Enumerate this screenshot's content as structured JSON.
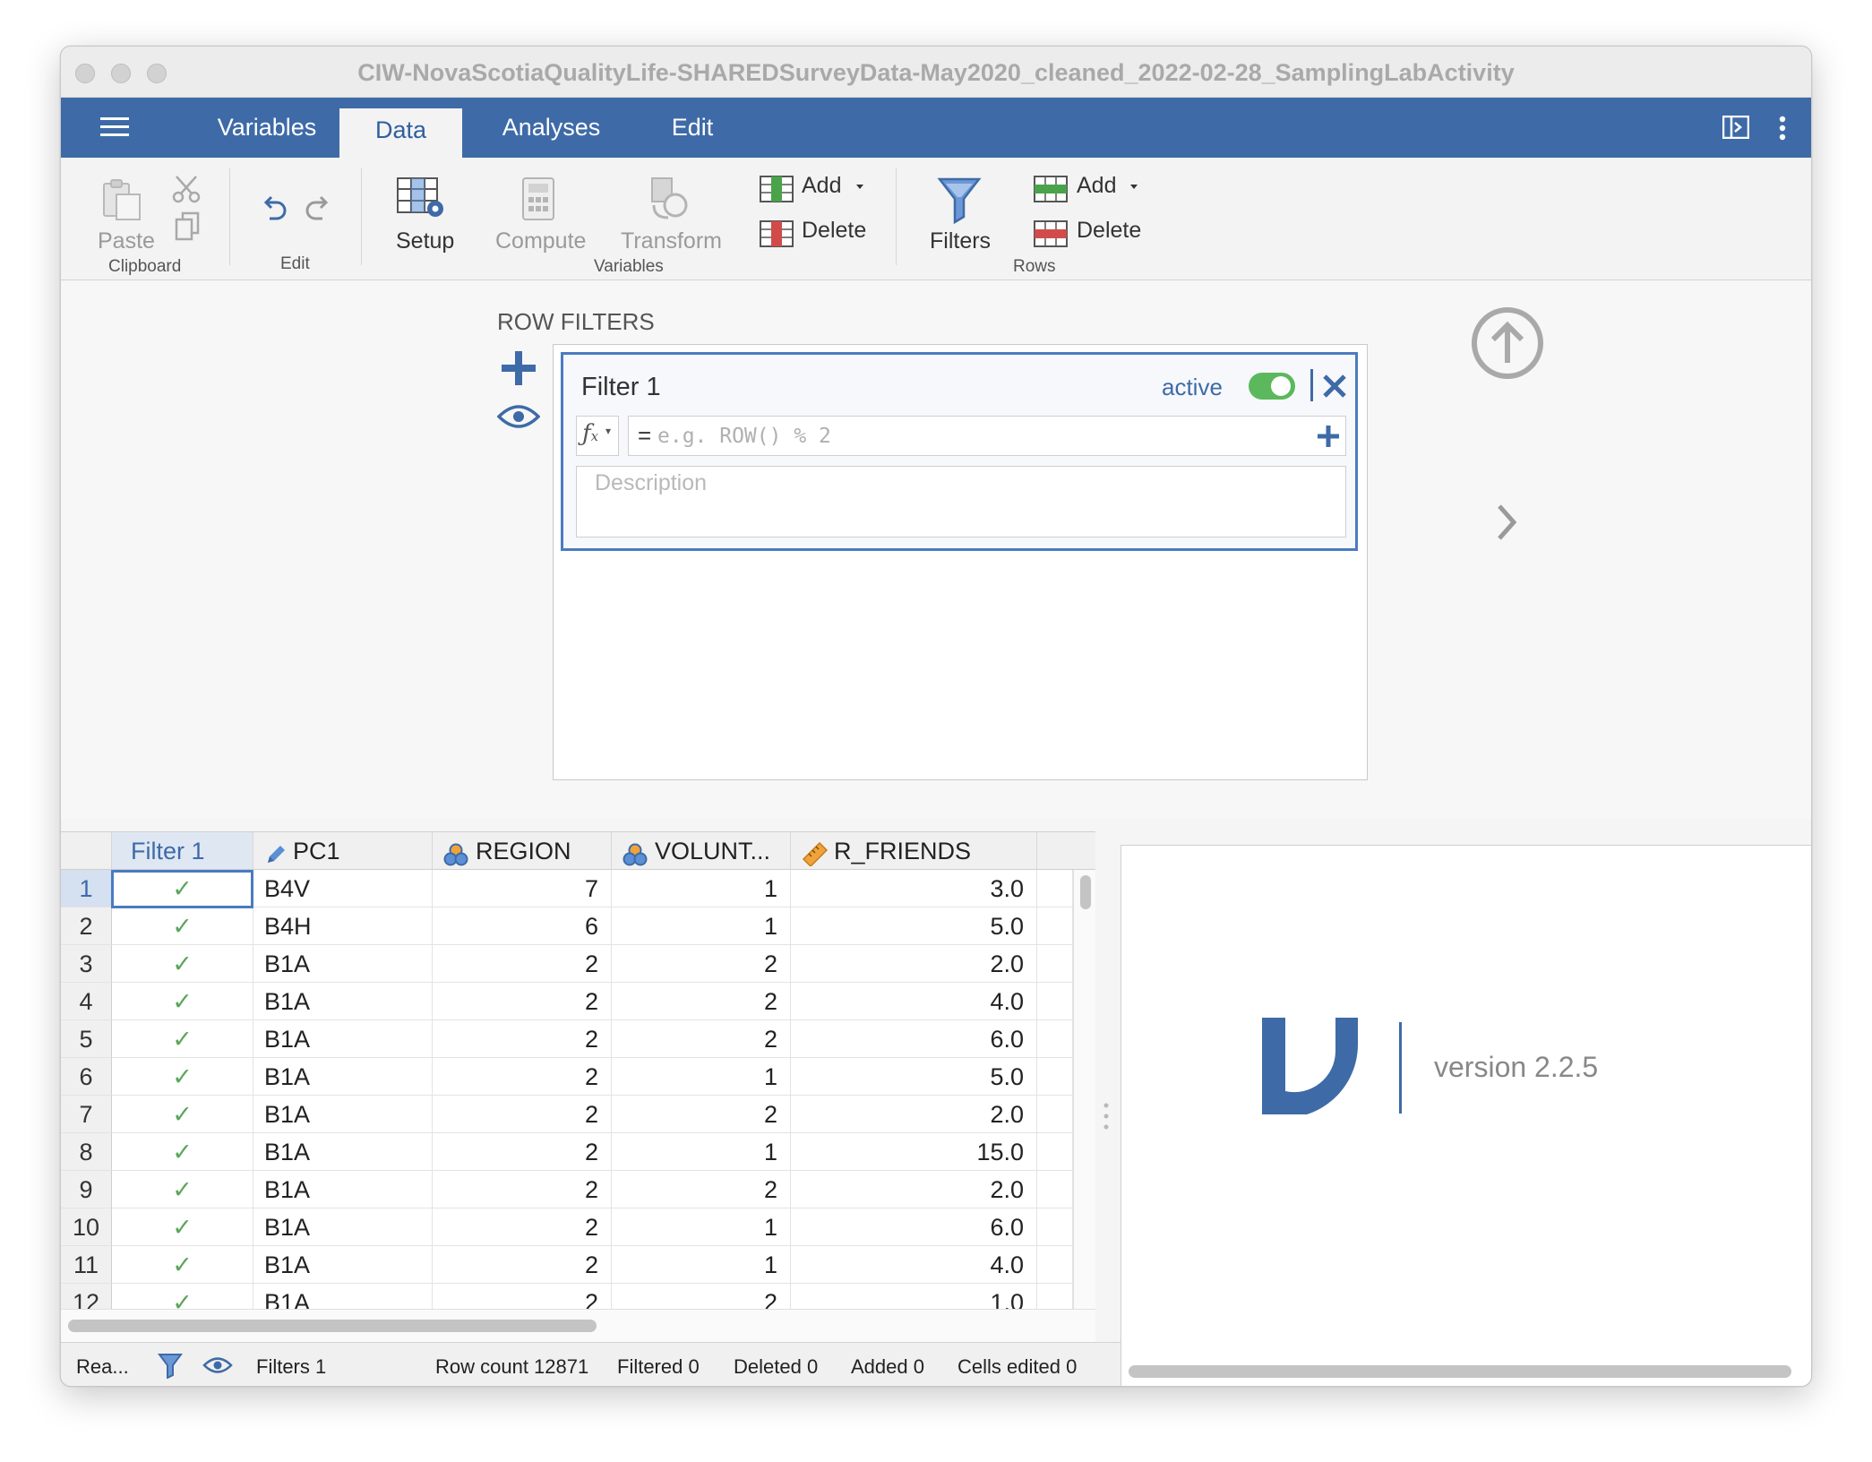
{
  "window": {
    "title": "CIW-NovaScotiaQualityLife-SHAREDSurveyData-May2020_cleaned_2022-02-28_SamplingLabActivity"
  },
  "nav": {
    "tabs": [
      {
        "label": "Variables"
      },
      {
        "label": "Data"
      },
      {
        "label": "Analyses"
      },
      {
        "label": "Edit"
      }
    ],
    "active_tab": "Data"
  },
  "ribbon": {
    "paste_label": "Paste",
    "clipboard_group": "Clipboard",
    "edit_group": "Edit",
    "setup_label": "Setup",
    "compute_label": "Compute",
    "transform_label": "Transform",
    "variables_group": "Variables",
    "var_add_label": "Add",
    "var_delete_label": "Delete",
    "filters_label": "Filters",
    "row_add_label": "Add",
    "row_delete_label": "Delete",
    "rows_group": "Rows"
  },
  "row_filters": {
    "heading": "ROW FILTERS",
    "filter_name": "Filter 1",
    "active_label": "active",
    "active": true,
    "formula_prefix": "=",
    "formula_placeholder": "e.g. ROW() % 2",
    "description_placeholder": "Description"
  },
  "grid": {
    "columns": [
      {
        "name": "Filter 1",
        "icon": "filter-column-icon"
      },
      {
        "name": "PC1",
        "icon": "pencil-nominal-text-icon"
      },
      {
        "name": "REGION",
        "icon": "nominal-circles-icon"
      },
      {
        "name": "VOLUNT...",
        "icon": "nominal-circles-icon"
      },
      {
        "name": "R_FRIENDS",
        "icon": "ruler-continuous-icon"
      }
    ],
    "check_glyph": "✓",
    "rows": [
      {
        "n": "1",
        "pc1": "B4V",
        "region": "7",
        "volunt": "1",
        "friends": "3.0"
      },
      {
        "n": "2",
        "pc1": "B4H",
        "region": "6",
        "volunt": "1",
        "friends": "5.0"
      },
      {
        "n": "3",
        "pc1": "B1A",
        "region": "2",
        "volunt": "2",
        "friends": "2.0"
      },
      {
        "n": "4",
        "pc1": "B1A",
        "region": "2",
        "volunt": "2",
        "friends": "4.0"
      },
      {
        "n": "5",
        "pc1": "B1A",
        "region": "2",
        "volunt": "2",
        "friends": "6.0"
      },
      {
        "n": "6",
        "pc1": "B1A",
        "region": "2",
        "volunt": "1",
        "friends": "5.0"
      },
      {
        "n": "7",
        "pc1": "B1A",
        "region": "2",
        "volunt": "2",
        "friends": "2.0"
      },
      {
        "n": "8",
        "pc1": "B1A",
        "region": "2",
        "volunt": "1",
        "friends": "15.0"
      },
      {
        "n": "9",
        "pc1": "B1A",
        "region": "2",
        "volunt": "2",
        "friends": "2.0"
      },
      {
        "n": "10",
        "pc1": "B1A",
        "region": "2",
        "volunt": "1",
        "friends": "6.0"
      },
      {
        "n": "11",
        "pc1": "B1A",
        "region": "2",
        "volunt": "1",
        "friends": "4.0"
      },
      {
        "n": "12",
        "pc1": "B1A",
        "region": "2",
        "volunt": "2",
        "friends": "1.0"
      }
    ]
  },
  "status": {
    "ready": "Rea...",
    "filters": "Filters 1",
    "row_count": "Row count 12871",
    "filtered": "Filtered 0",
    "deleted": "Deleted 0",
    "added": "Added 0",
    "cells_edited": "Cells edited 0"
  },
  "results": {
    "version": "version 2.2.5"
  },
  "colors": {
    "brand_blue": "#3e6ba7",
    "accent_blue": "#4a7bc0",
    "toggle_green": "#5cb85c",
    "check_green": "#5aa55a"
  }
}
